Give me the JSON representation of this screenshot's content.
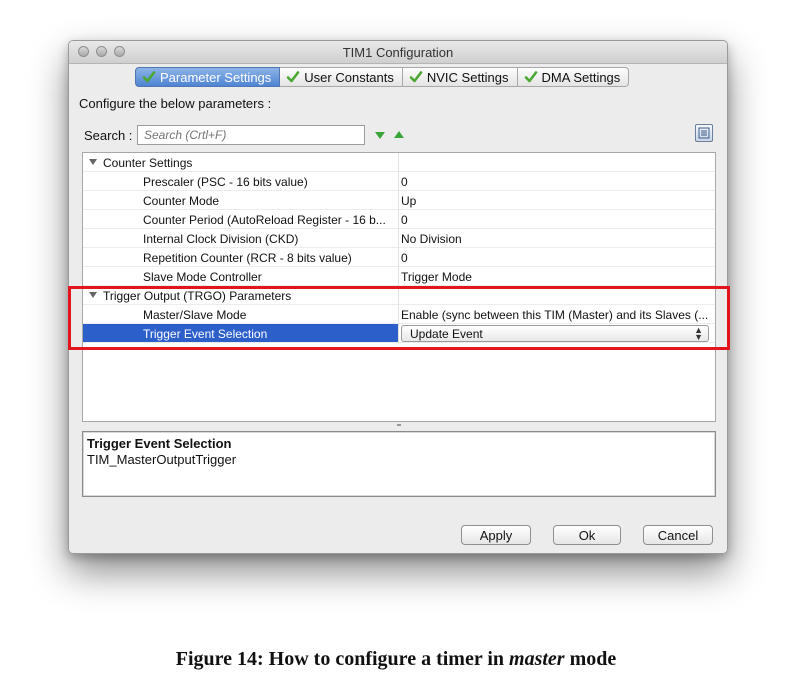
{
  "window": {
    "title": "TIM1 Configuration"
  },
  "tabs": [
    {
      "label": "Parameter Settings",
      "active": true
    },
    {
      "label": "User Constants",
      "active": false
    },
    {
      "label": "NVIC Settings",
      "active": false
    },
    {
      "label": "DMA Settings",
      "active": false
    }
  ],
  "configure_label": "Configure the below parameters :",
  "search": {
    "label": "Search :",
    "placeholder": "Search (Crtl+F)"
  },
  "parameters": {
    "groups": [
      {
        "name": "Counter Settings",
        "rows": [
          {
            "name": "Prescaler (PSC - 16 bits value)",
            "value": "0"
          },
          {
            "name": "Counter Mode",
            "value": "Up"
          },
          {
            "name": "Counter Period (AutoReload Register - 16 b...",
            "value": "0"
          },
          {
            "name": "Internal Clock Division (CKD)",
            "value": "No Division"
          },
          {
            "name": "Repetition Counter (RCR - 8 bits value)",
            "value": "0"
          },
          {
            "name": "Slave Mode Controller",
            "value": "Trigger Mode"
          }
        ]
      },
      {
        "name": "Trigger Output (TRGO) Parameters",
        "rows": [
          {
            "name": "Master/Slave Mode",
            "value": "Enable (sync between this TIM (Master) and its Slaves (..."
          },
          {
            "name": "Trigger Event Selection",
            "value": "Update Event",
            "selected": true
          }
        ]
      }
    ]
  },
  "description": {
    "title": "Trigger Event Selection",
    "text": "TIM_MasterOutputTrigger"
  },
  "buttons": {
    "apply": "Apply",
    "ok": "Ok",
    "cancel": "Cancel"
  },
  "caption": {
    "prefix": "Figure 14: How to configure a timer in ",
    "emph": "master",
    "suffix": " mode"
  },
  "colors": {
    "highlight": "#e4141c",
    "selection": "#2d5fcb",
    "active_tab": "#4f84d3",
    "check": "#4aa832"
  }
}
